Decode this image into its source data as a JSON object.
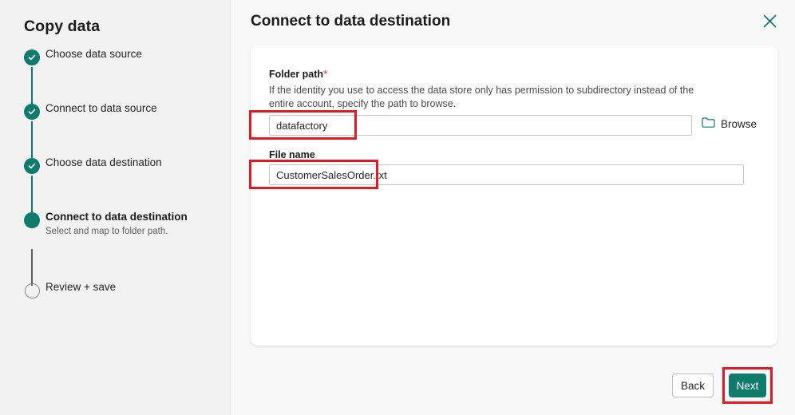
{
  "theme": {
    "accent": "#0f7b6c",
    "annotation": "#e01b24",
    "required_star": "#c9203f",
    "sidebar_bg": "#f2f2f2",
    "panel_bg": "#f8f8f8",
    "card_bg": "#ffffff"
  },
  "sidebar": {
    "title": "Copy data",
    "steps": [
      {
        "label": "Choose data source",
        "state": "done",
        "sub": ""
      },
      {
        "label": "Connect to data source",
        "state": "done",
        "sub": ""
      },
      {
        "label": "Choose data destination",
        "state": "done",
        "sub": ""
      },
      {
        "label": "Connect to data destination",
        "state": "current",
        "sub": "Select and map to folder path."
      },
      {
        "label": "Review + save",
        "state": "todo",
        "sub": ""
      }
    ]
  },
  "panel": {
    "title": "Connect to data destination",
    "close_icon": "close-icon"
  },
  "form": {
    "folder_path": {
      "label": "Folder path",
      "required_marker": "*",
      "description": "If the identity you use to access the data store only has permission to subdirectory instead of the entire account, specify the path to browse.",
      "value": "datafactory",
      "placeholder": "",
      "browse_label": "Browse",
      "browse_icon": "folder-icon"
    },
    "file_name": {
      "label": "File name",
      "value": "CustomerSalesOrder.txt",
      "placeholder": ""
    }
  },
  "footer": {
    "back_label": "Back",
    "next_label": "Next"
  }
}
